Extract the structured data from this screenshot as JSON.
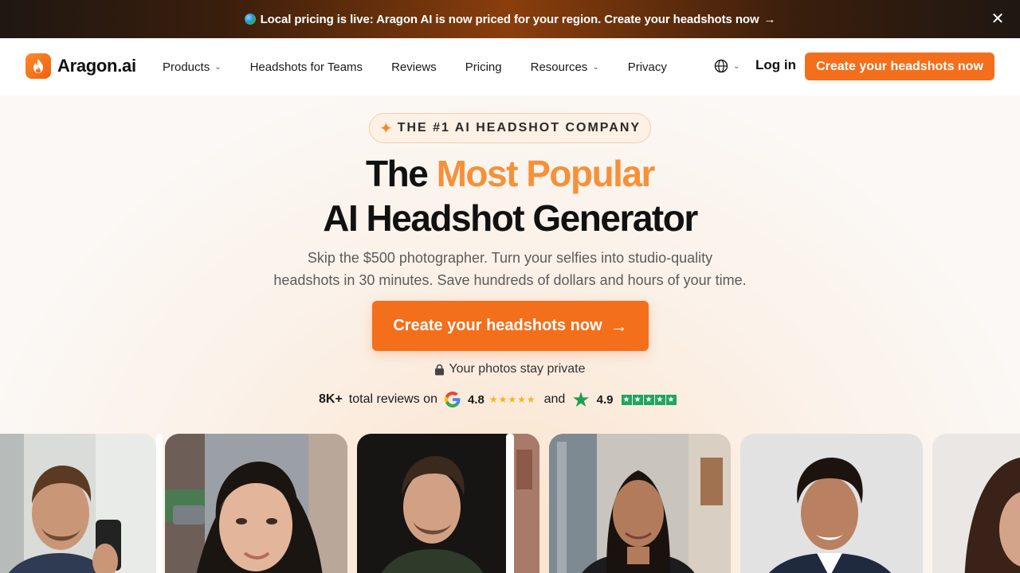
{
  "banner": {
    "text": "Local pricing is live: Aragon AI is now priced for your region. Create your headshots now",
    "arrow": "→"
  },
  "nav": {
    "logo_text": "Aragon.ai",
    "items": [
      {
        "label": "Products",
        "dropdown": true
      },
      {
        "label": "Headshots for Teams",
        "dropdown": false
      },
      {
        "label": "Reviews",
        "dropdown": false
      },
      {
        "label": "Pricing",
        "dropdown": false
      },
      {
        "label": "Resources",
        "dropdown": true
      },
      {
        "label": "Privacy",
        "dropdown": false
      }
    ],
    "login": "Log in",
    "cta": "Create your headshots now"
  },
  "hero": {
    "badge": "THE #1 AI HEADSHOT COMPANY",
    "headline_part1": "The",
    "headline_accent": "Most Popular",
    "headline_line2": "AI Headshot Generator",
    "subtitle_line1": "Skip the $500 photographer. Turn your selfies into studio-quality",
    "subtitle_line2": "headshots in 30 minutes. Save hundreds of dollars and hours of your time.",
    "cta": "Create your headshots now",
    "private_note": "Your photos stay private",
    "reviews": {
      "count": "8K+",
      "text": "total reviews on",
      "google_rating": "4.8",
      "and": "and",
      "trustpilot_rating": "4.9"
    }
  },
  "colors": {
    "accent": "#f36f1c",
    "accent_light": "#f5913a",
    "trustpilot": "#20a562",
    "google_star": "#f6b51e"
  }
}
